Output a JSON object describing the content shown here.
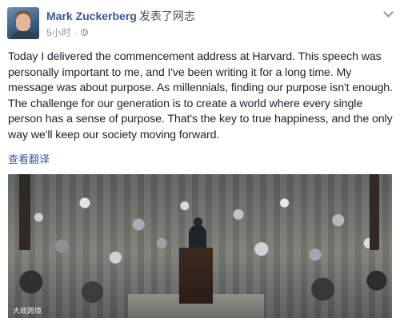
{
  "post": {
    "author_name": "Mark Zuckerberg",
    "action_text": "发表了网志",
    "time_text": "5小时",
    "separator": "·",
    "privacy_icon": "globe-icon",
    "menu_icon": "chevron-down-icon",
    "body": "Today I delivered the commencement address at Harvard. This speech was personally important to me, and I've been writing it for a long time. My message was about purpose. As millennials, finding our purpose isn't enough. The challenge for our generation is to create a world where every single person has a sense of purpose. That's the key to true happiness, and the only way we'll keep our society moving forward.",
    "translate_label": "查看翻译",
    "photo_watermark": "大政跨境"
  },
  "colors": {
    "link_blue": "#365899",
    "text_dark": "#1d2129",
    "meta_gray": "#90949c"
  }
}
